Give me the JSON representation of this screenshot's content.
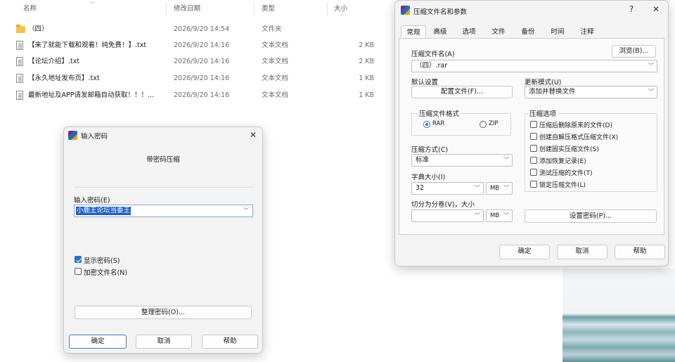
{
  "explorer": {
    "columns": {
      "name": "名称",
      "date": "修改日期",
      "type": "类型",
      "size": "大小"
    },
    "files": [
      {
        "icon": "folder-icon",
        "name": "（四）",
        "date": "2026/9/20 14:54",
        "type": "文件夹",
        "size": ""
      },
      {
        "icon": "text-file-icon",
        "name": "【来了就能下载和观看！纯免费！】.txt",
        "date": "2026/9/20 14:16",
        "type": "文本文档",
        "size": "2 KB"
      },
      {
        "icon": "text-file-icon",
        "name": "【论坛介绍】.txt",
        "date": "2026/9/20 14:16",
        "type": "文本文档",
        "size": "2 KB"
      },
      {
        "icon": "text-file-icon",
        "name": "【永久地址发布页】.txt",
        "date": "2026/9/20 14:16",
        "type": "文本文档",
        "size": "1 KB"
      },
      {
        "icon": "text-file-icon",
        "name": "最新地址及APP请发邮箱自动获取！！！...",
        "date": "2026/9/20 14:16",
        "type": "文本文档",
        "size": "1 KB"
      }
    ]
  },
  "winrar": {
    "title": "压缩文件名和参数",
    "help_glyph": "?",
    "close_glyph": "✕",
    "tabs": [
      "常规",
      "高级",
      "选项",
      "文件",
      "备份",
      "时间",
      "注释"
    ],
    "archive_name_label": "压缩文件名(A)",
    "browse_button": "浏览(B)...",
    "archive_name_value": "（四）.rar",
    "profile_label": "默认设置",
    "profile_button": "配置文件(F)...",
    "update_mode_label": "更新模式(U)",
    "update_mode_value": "添加并替换文件",
    "format_label": "压缩文件格式",
    "format_rar": "RAR",
    "format_zip": "ZIP",
    "method_label": "压缩方式(C)",
    "method_value": "标准",
    "dict_label": "字典大小(I)",
    "dict_value": "32",
    "dict_unit": "MB",
    "split_label": "切分为分卷(V)，大小",
    "split_value": "",
    "split_unit": "MB",
    "options_label": "压缩选项",
    "options": [
      {
        "label": "压缩后删除原来的文件(D)",
        "checked": false
      },
      {
        "label": "创建自解压格式压缩文件(X)",
        "checked": false
      },
      {
        "label": "创建固实压缩文件(S)",
        "checked": false
      },
      {
        "label": "添加恢复记录(E)",
        "checked": false
      },
      {
        "label": "测试压缩的文件(T)",
        "checked": false
      },
      {
        "label": "锁定压缩文件(L)",
        "checked": false
      }
    ],
    "set_password_button": "设置密码(P)...",
    "ok_button": "确定",
    "cancel_button": "取消",
    "help_button": "帮助"
  },
  "password_dialog": {
    "title": "输入密码",
    "close_glyph": "✕",
    "heading": "带密码压缩",
    "enter_label": "输入密码(E)",
    "password_value": "小鹿王论坛当委王",
    "show_password": {
      "label": "显示密码(S)",
      "checked": true
    },
    "encrypt_names": {
      "label": "加密文件名(N)",
      "checked": false
    },
    "organize_button": "整理密码(O)...",
    "ok_button": "确定",
    "cancel_button": "取消",
    "help_button": "帮助"
  }
}
